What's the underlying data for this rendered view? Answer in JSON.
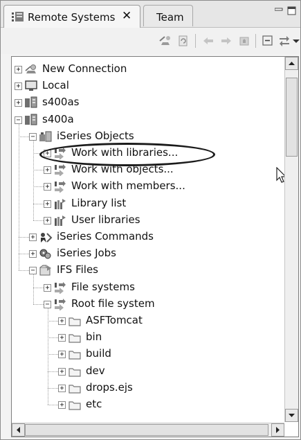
{
  "view": {
    "tabs": [
      {
        "label": "Remote Systems",
        "close": "✕",
        "active": true
      },
      {
        "label": "Team",
        "active": false
      }
    ],
    "window_controls": [
      "minimize-icon",
      "maximize-icon"
    ]
  },
  "toolbar": {
    "icons": [
      "new-connection-icon",
      "refresh-icon",
      "back-icon",
      "forward-icon",
      "home-icon",
      "collapse-all-icon",
      "link-with-editor-icon",
      "view-menu-icon"
    ]
  },
  "tree": {
    "items": [
      {
        "label": "New Connection",
        "expander": "+",
        "icon": "new-connection-icon"
      },
      {
        "label": "Local",
        "expander": "+",
        "icon": "monitor-icon"
      },
      {
        "label": "s400as",
        "expander": "+",
        "icon": "server-icon"
      },
      {
        "label": "s400a",
        "expander": "−",
        "icon": "server-icon"
      },
      {
        "label": "iSeries Objects",
        "expander": "−",
        "icon": "iseries-objects-icon"
      },
      {
        "label": "Work with libraries...",
        "expander": "+",
        "icon": "filter-icon",
        "highlighted": true
      },
      {
        "label": "Work with objects...",
        "expander": "+",
        "icon": "filter-icon"
      },
      {
        "label": "Work with members...",
        "expander": "+",
        "icon": "filter-icon"
      },
      {
        "label": "Library list",
        "expander": "+",
        "icon": "library-icon"
      },
      {
        "label": "User libraries",
        "expander": "+",
        "icon": "library-icon"
      },
      {
        "label": "iSeries Commands",
        "expander": "+",
        "icon": "commands-icon"
      },
      {
        "label": "iSeries Jobs",
        "expander": "+",
        "icon": "jobs-icon"
      },
      {
        "label": "IFS Files",
        "expander": "−",
        "icon": "ifs-icon"
      },
      {
        "label": "File systems",
        "expander": "+",
        "icon": "filter-icon"
      },
      {
        "label": "Root file system",
        "expander": "−",
        "icon": "filter-icon"
      },
      {
        "label": "ASFTomcat",
        "expander": "+",
        "icon": "folder-icon"
      },
      {
        "label": "bin",
        "expander": "+",
        "icon": "folder-icon"
      },
      {
        "label": "build",
        "expander": "+",
        "icon": "folder-icon"
      },
      {
        "label": "dev",
        "expander": "+",
        "icon": "folder-icon"
      },
      {
        "label": "drops.ejs",
        "expander": "+",
        "icon": "folder-icon"
      },
      {
        "label": "etc",
        "expander": "+",
        "icon": "folder-icon"
      }
    ]
  },
  "colors": {
    "accent": "#1b1b1b",
    "folder": "#d8d8d8"
  }
}
